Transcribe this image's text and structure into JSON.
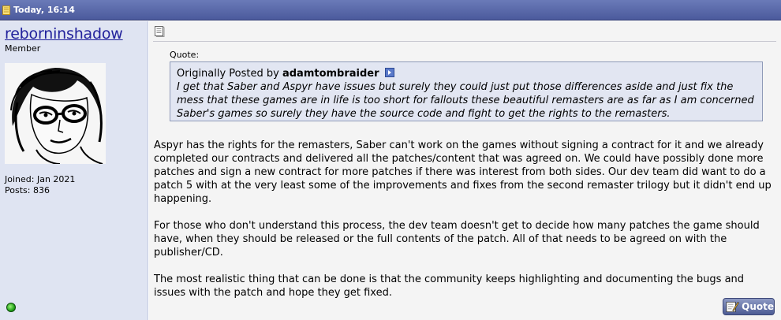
{
  "header": {
    "date": "Today, 16:14",
    "icon": "document-icon"
  },
  "user": {
    "username": "reborninshadow",
    "title": "Member",
    "joined": "Joined: Jan 2021",
    "posts": "Posts: 836",
    "online_status": "online"
  },
  "post": {
    "quote_label": "Quote:",
    "quote_prefix": "Originally Posted by ",
    "quote_author": "adamtombraider",
    "quote_text": "I get that Saber and Aspyr have issues but surely they could just put those differences aside and just fix the mess that these games are in life is too short for fallouts these beautiful remasters are as far as I am concerned Saber's games so surely they have the source code and fight to get the rights to the remasters.",
    "paragraphs": [
      "Aspyr has the rights for the remasters, Saber can't work on the games without signing a contract for it and we already completed our contracts and delivered all the patches/content that was agreed on. We could have possibly done more patches and sign a new contract for more patches if there was interest from both sides. Our dev team did want to do a patch 5 with at the very least some of the improvements and fixes from the second remaster trilogy but it didn't end up happening.",
      "For those who don't understand this process, the dev team doesn't get to decide how many patches the game should have, when they should be released or the full contents of the patch. All of that needs to be agreed on with the publisher/CD.",
      "The most realistic thing that can be done is that the community keeps highlighting and documenting the bugs and issues with the patch and hope they get fixed."
    ],
    "quote_button_label": "Quote"
  },
  "colors": {
    "header_bg": "#4b5a9c",
    "userinfo_bg": "#dfe4f2",
    "postbody_bg": "#f4f4f4",
    "quote_bg": "#e2e6f2",
    "username": "#22229c"
  }
}
